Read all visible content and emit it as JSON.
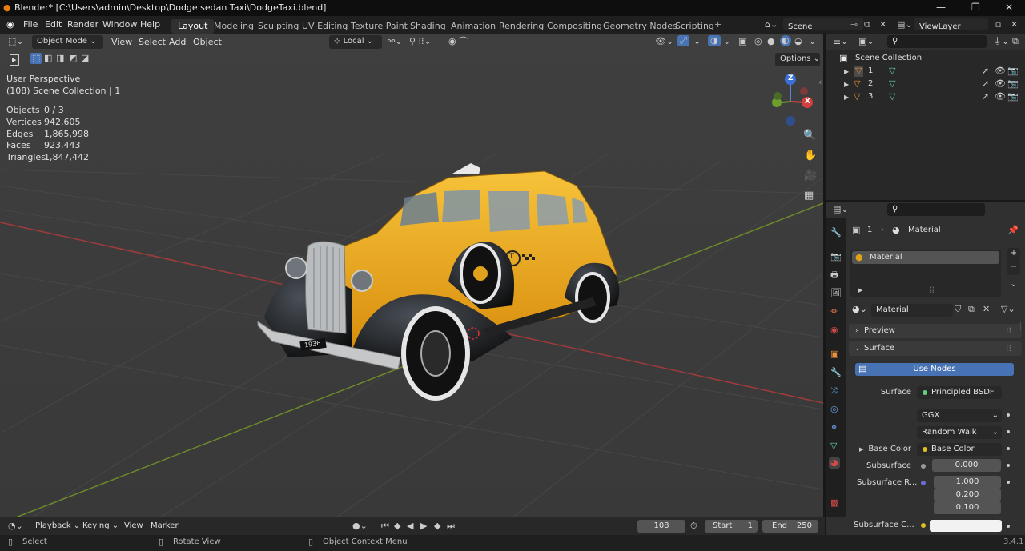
{
  "titlebar": {
    "title": "Blender* [C:\\Users\\admin\\Desktop\\Dodge sedan Taxi\\DodgeTaxi.blend]",
    "minimize": "—",
    "maximize": "❐",
    "close": "✕"
  },
  "menu": [
    "File",
    "Edit",
    "Render",
    "Window",
    "Help"
  ],
  "workspaces": [
    "Layout",
    "Modeling",
    "Sculpting",
    "UV Editing",
    "Texture Paint",
    "Shading",
    "Animation",
    "Rendering",
    "Compositing",
    "Geometry Nodes",
    "Scripting"
  ],
  "active_workspace": "Layout",
  "add_workspace": "+",
  "scene": {
    "label": "Scene"
  },
  "view_layer": {
    "label": "ViewLayer"
  },
  "viewport": {
    "mode": "Object Mode",
    "menus": [
      "View",
      "Select",
      "Add",
      "Object"
    ],
    "transform_orientation": "Local",
    "options": "Options",
    "overlay_title": "User Perspective",
    "overlay_collection": "(108) Scene Collection | 1",
    "stats": [
      {
        "label": "Objects",
        "value": "0 / 3"
      },
      {
        "label": "Vertices",
        "value": "942,605"
      },
      {
        "label": "Edges",
        "value": "1,865,998"
      },
      {
        "label": "Faces",
        "value": "923,443"
      },
      {
        "label": "Triangles",
        "value": "1,847,442"
      }
    ],
    "gizmo": {
      "z": "Z",
      "x": "X"
    },
    "plate": "1936",
    "taxi_emblem": "T",
    "colors": {
      "body": "#f2a81b",
      "fender": "#101010",
      "floor": "#3d3d3d",
      "x_axis": "#b03c3c",
      "y_axis": "#6c8a2a"
    }
  },
  "outliner": {
    "root": "Scene Collection",
    "items": [
      "1",
      "2",
      "3"
    ]
  },
  "properties": {
    "breadcrumb_object": "1",
    "breadcrumb_material": "Material",
    "slot_name": "Material",
    "material_name": "Material",
    "preview_label": "Preview",
    "surface_label": "Surface",
    "use_nodes": "Use Nodes",
    "surface_field_label": "Surface",
    "surface_value": "Principled BSDF",
    "distribution": "GGX",
    "subsurface_method": "Random Walk",
    "base_color_label": "Base Color",
    "base_color_value": "Base Color",
    "subsurface_label": "Subsurface",
    "subsurface_value": "0.000",
    "subsurface_radius_label": "Subsurface R...",
    "subsurface_radius": [
      "1.000",
      "0.200",
      "0.100"
    ],
    "subsurface_color_label": "Subsurface C...",
    "accent": "#4772b3"
  },
  "timeline": {
    "menus": [
      "Playback",
      "Keying",
      "View",
      "Marker"
    ],
    "current_frame": "108",
    "start_label": "Start",
    "start": "1",
    "end_label": "End",
    "end": "250"
  },
  "statusbar": {
    "select": "Select",
    "rotate": "Rotate View",
    "context": "Object Context Menu",
    "version": "3.4.1"
  }
}
